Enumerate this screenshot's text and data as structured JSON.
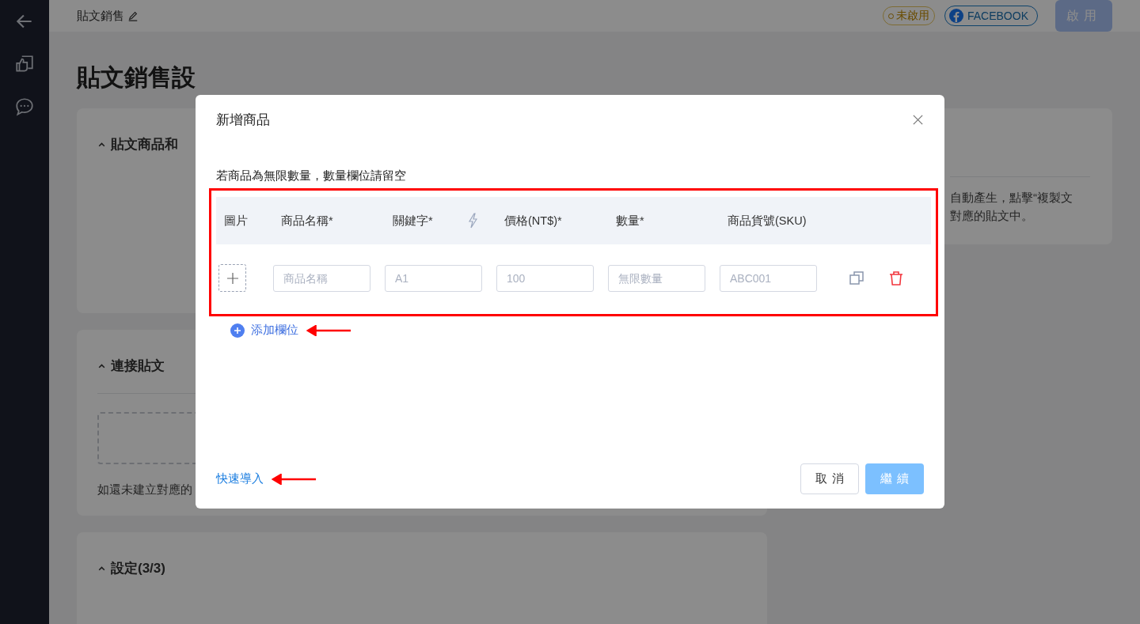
{
  "header": {
    "title": "貼文銷售",
    "status": "未啟用",
    "platform": "FACEBOOK",
    "enable_button": {
      "label": "啟用",
      "disabled": true
    }
  },
  "page": {
    "title": "貼文銷售設",
    "sections": [
      {
        "title": "貼文商品和",
        "expanded": true
      },
      {
        "title": "連接貼文",
        "expanded": true,
        "hint": "如還未建立對應的"
      },
      {
        "title": "設定(3/3)",
        "expanded": true
      }
    ],
    "side_card": {
      "lines": [
        "自動產生，點擊“複製文",
        "對應的貼文中。"
      ]
    }
  },
  "modal": {
    "title": "新增商品",
    "notice": "若商品為無限數量，數量欄位請留空",
    "columns": [
      {
        "label": "圖片"
      },
      {
        "label": "商品名稱*"
      },
      {
        "label": "關鍵字*"
      },
      {
        "label": "價格(NT$)*"
      },
      {
        "label": "數量*"
      },
      {
        "label": "商品貨號(SKU)"
      }
    ],
    "rows": [
      {
        "fields": [
          {
            "placeholder": "商品名稱"
          },
          {
            "placeholder": "A1"
          },
          {
            "placeholder": "100"
          },
          {
            "placeholder": "無限數量"
          },
          {
            "placeholder": "ABC001"
          }
        ]
      }
    ],
    "add_row": "添加欄位",
    "quick_import": "快速導入",
    "cancel_button": {
      "label": "取消",
      "disabled": false
    },
    "continue_button": {
      "label": "繼續",
      "disabled": true
    }
  }
}
